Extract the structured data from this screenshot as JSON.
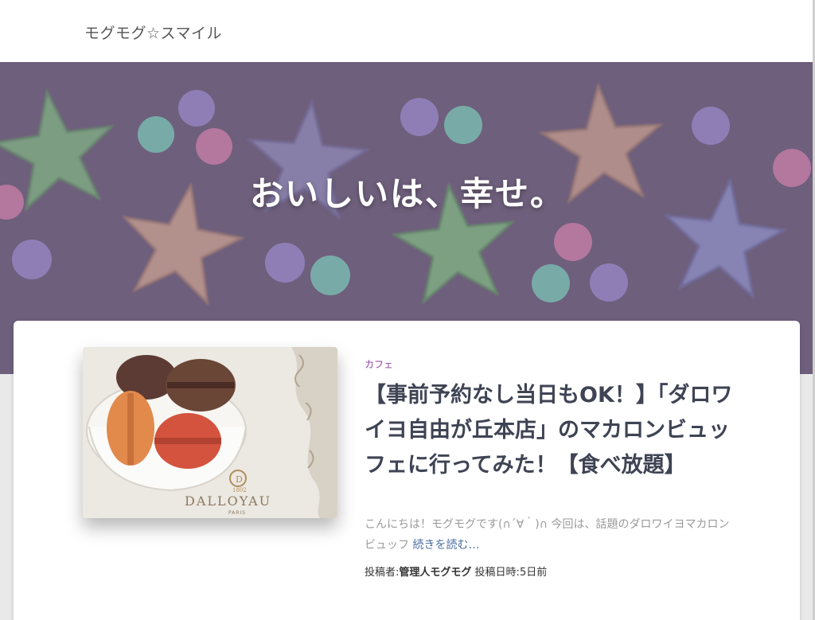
{
  "site": {
    "title": "モグモグ☆スマイル"
  },
  "hero": {
    "tagline": "おいしいは、幸せ。",
    "background_color": "#786a85"
  },
  "post": {
    "category": "カフェ",
    "title": "【事前予約なし当日もOK！】「ダロワイヨ自由が丘本店」のマカロンビュッフェに行ってみた！【食べ放題】",
    "excerpt": "こんにちは！モグモグです(∩´∀｀)∩ 今回は、話題のダロワイヨマカロンビュッフ",
    "read_more": "続きを読む…",
    "author_label": "投稿者:",
    "author_name": "管理人モグモグ",
    "date_label": "投稿日時:",
    "date_value": "5日前",
    "thumbnail": {
      "brand": "DALLOYAU",
      "city": "PARIS",
      "year": "1802"
    }
  },
  "colors": {
    "category": "#8e3fa3",
    "title": "#3f4454",
    "read_more": "#4b6ea0"
  }
}
